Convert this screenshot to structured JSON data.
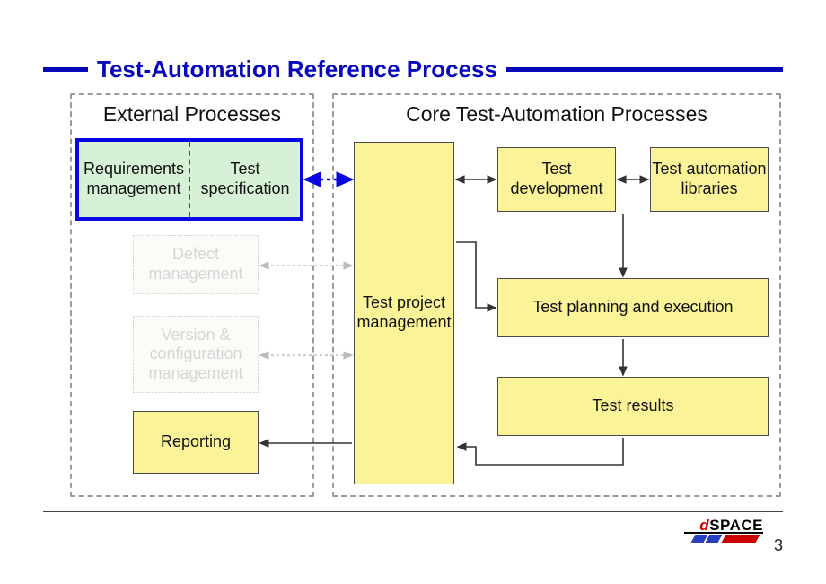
{
  "title": "Test-Automation Reference Process",
  "page_number": "3",
  "logo": {
    "d": "d",
    "rest": "SPACE"
  },
  "groups": {
    "external": {
      "title": "External Processes"
    },
    "core": {
      "title": "Core Test-Automation Processes"
    }
  },
  "boxes": {
    "req_mgmt": "Requirements management",
    "test_spec": "Test specification",
    "defect_mgmt": "Defect management",
    "vc_mgmt": "Version & configuration management",
    "reporting": "Reporting",
    "tpm": "Test project management",
    "test_dev": "Test development",
    "auto_libs": "Test automation libraries",
    "plan_exec": "Test planning and execution",
    "results": "Test results"
  }
}
